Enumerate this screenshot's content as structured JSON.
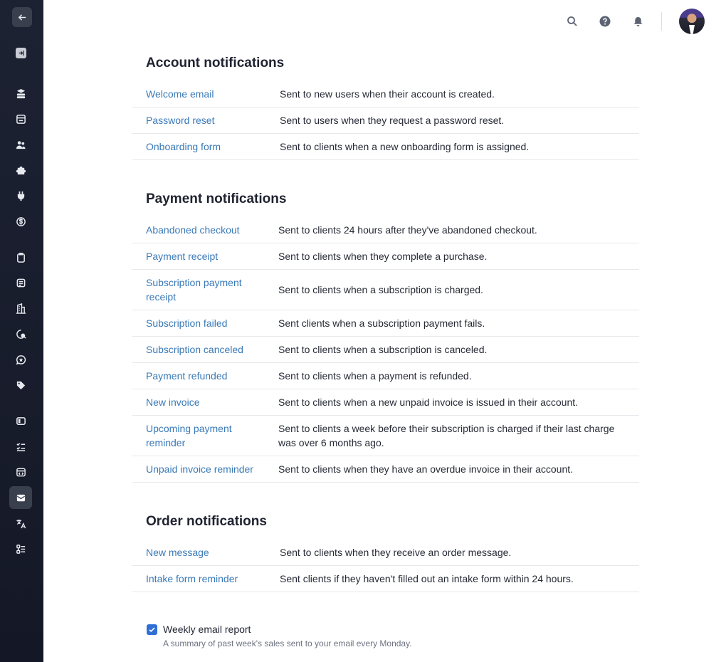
{
  "sidebar": {
    "items": [
      {
        "icon": "arrow-left-icon"
      },
      {
        "icon": "collapse-sidebar-icon"
      },
      {
        "icon": "stack-icon"
      },
      {
        "icon": "inbox-icon"
      },
      {
        "icon": "users-icon"
      },
      {
        "icon": "puzzle-icon"
      },
      {
        "icon": "plug-icon"
      },
      {
        "icon": "coin-icon"
      },
      {
        "icon": "clipboard-icon"
      },
      {
        "icon": "document-icon"
      },
      {
        "icon": "building-icon"
      },
      {
        "icon": "chat-search-icon"
      },
      {
        "icon": "star-chat-icon"
      },
      {
        "icon": "tag-icon"
      },
      {
        "icon": "panel-icon"
      },
      {
        "icon": "checklist-icon"
      },
      {
        "icon": "code-window-icon"
      },
      {
        "icon": "envelope-icon"
      },
      {
        "icon": "translate-icon"
      },
      {
        "icon": "list-settings-icon"
      }
    ],
    "active": "envelope-icon"
  },
  "topbar": {
    "icons": [
      "search-icon",
      "help-icon",
      "bell-icon"
    ]
  },
  "account": {
    "title": "Account notifications",
    "rows": [
      {
        "name": "Welcome email",
        "desc": "Sent to new users when their account is created."
      },
      {
        "name": "Password reset",
        "desc": "Sent to users when they request a password reset."
      },
      {
        "name": "Onboarding form",
        "desc": "Sent to clients when a new onboarding form is assigned."
      }
    ]
  },
  "payment": {
    "title": "Payment notifications",
    "rows": [
      {
        "name": "Abandoned checkout",
        "desc": "Sent to clients 24 hours after they've abandoned checkout."
      },
      {
        "name": "Payment receipt",
        "desc": "Sent to clients when they complete a purchase."
      },
      {
        "name": "Subscription payment receipt",
        "desc": "Sent to clients when a subscription is charged."
      },
      {
        "name": "Subscription failed",
        "desc": "Sent clients when a subscription payment fails."
      },
      {
        "name": "Subscription canceled",
        "desc": "Sent to clients when a subscription is canceled."
      },
      {
        "name": "Payment refunded",
        "desc": "Sent to clients when a payment is refunded."
      },
      {
        "name": "New invoice",
        "desc": "Sent to clients when a new unpaid invoice is issued in their account."
      },
      {
        "name": "Upcoming payment reminder",
        "desc": "Sent to clients a week before their subscription is charged if their last charge was over 6 months ago."
      },
      {
        "name": "Unpaid invoice reminder",
        "desc": "Sent to clients when they have an overdue invoice in their account."
      }
    ]
  },
  "order": {
    "title": "Order notifications",
    "rows": [
      {
        "name": "New message",
        "desc": "Sent to clients when they receive an order message."
      },
      {
        "name": "Intake form reminder",
        "desc": "Sent clients if they haven't filled out an intake form within 24 hours."
      }
    ]
  },
  "weekly": {
    "checked": true,
    "label": "Weekly email report",
    "help": "A summary of past week's sales sent to your email every Monday."
  }
}
